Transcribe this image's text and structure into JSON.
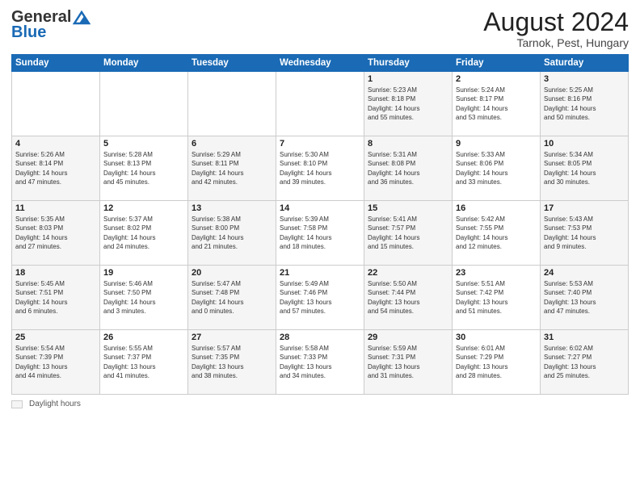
{
  "header": {
    "logo_general": "General",
    "logo_blue": "Blue",
    "month_year": "August 2024",
    "location": "Tarnok, Pest, Hungary"
  },
  "weekdays": [
    "Sunday",
    "Monday",
    "Tuesday",
    "Wednesday",
    "Thursday",
    "Friday",
    "Saturday"
  ],
  "legend": {
    "label": "Daylight hours",
    "box_color": "#f5f5f5"
  },
  "weeks": [
    [
      {
        "day": "",
        "info": ""
      },
      {
        "day": "",
        "info": ""
      },
      {
        "day": "",
        "info": ""
      },
      {
        "day": "",
        "info": ""
      },
      {
        "day": "1",
        "info": "Sunrise: 5:23 AM\nSunset: 8:18 PM\nDaylight: 14 hours\nand 55 minutes."
      },
      {
        "day": "2",
        "info": "Sunrise: 5:24 AM\nSunset: 8:17 PM\nDaylight: 14 hours\nand 53 minutes."
      },
      {
        "day": "3",
        "info": "Sunrise: 5:25 AM\nSunset: 8:16 PM\nDaylight: 14 hours\nand 50 minutes."
      }
    ],
    [
      {
        "day": "4",
        "info": "Sunrise: 5:26 AM\nSunset: 8:14 PM\nDaylight: 14 hours\nand 47 minutes."
      },
      {
        "day": "5",
        "info": "Sunrise: 5:28 AM\nSunset: 8:13 PM\nDaylight: 14 hours\nand 45 minutes."
      },
      {
        "day": "6",
        "info": "Sunrise: 5:29 AM\nSunset: 8:11 PM\nDaylight: 14 hours\nand 42 minutes."
      },
      {
        "day": "7",
        "info": "Sunrise: 5:30 AM\nSunset: 8:10 PM\nDaylight: 14 hours\nand 39 minutes."
      },
      {
        "day": "8",
        "info": "Sunrise: 5:31 AM\nSunset: 8:08 PM\nDaylight: 14 hours\nand 36 minutes."
      },
      {
        "day": "9",
        "info": "Sunrise: 5:33 AM\nSunset: 8:06 PM\nDaylight: 14 hours\nand 33 minutes."
      },
      {
        "day": "10",
        "info": "Sunrise: 5:34 AM\nSunset: 8:05 PM\nDaylight: 14 hours\nand 30 minutes."
      }
    ],
    [
      {
        "day": "11",
        "info": "Sunrise: 5:35 AM\nSunset: 8:03 PM\nDaylight: 14 hours\nand 27 minutes."
      },
      {
        "day": "12",
        "info": "Sunrise: 5:37 AM\nSunset: 8:02 PM\nDaylight: 14 hours\nand 24 minutes."
      },
      {
        "day": "13",
        "info": "Sunrise: 5:38 AM\nSunset: 8:00 PM\nDaylight: 14 hours\nand 21 minutes."
      },
      {
        "day": "14",
        "info": "Sunrise: 5:39 AM\nSunset: 7:58 PM\nDaylight: 14 hours\nand 18 minutes."
      },
      {
        "day": "15",
        "info": "Sunrise: 5:41 AM\nSunset: 7:57 PM\nDaylight: 14 hours\nand 15 minutes."
      },
      {
        "day": "16",
        "info": "Sunrise: 5:42 AM\nSunset: 7:55 PM\nDaylight: 14 hours\nand 12 minutes."
      },
      {
        "day": "17",
        "info": "Sunrise: 5:43 AM\nSunset: 7:53 PM\nDaylight: 14 hours\nand 9 minutes."
      }
    ],
    [
      {
        "day": "18",
        "info": "Sunrise: 5:45 AM\nSunset: 7:51 PM\nDaylight: 14 hours\nand 6 minutes."
      },
      {
        "day": "19",
        "info": "Sunrise: 5:46 AM\nSunset: 7:50 PM\nDaylight: 14 hours\nand 3 minutes."
      },
      {
        "day": "20",
        "info": "Sunrise: 5:47 AM\nSunset: 7:48 PM\nDaylight: 14 hours\nand 0 minutes."
      },
      {
        "day": "21",
        "info": "Sunrise: 5:49 AM\nSunset: 7:46 PM\nDaylight: 13 hours\nand 57 minutes."
      },
      {
        "day": "22",
        "info": "Sunrise: 5:50 AM\nSunset: 7:44 PM\nDaylight: 13 hours\nand 54 minutes."
      },
      {
        "day": "23",
        "info": "Sunrise: 5:51 AM\nSunset: 7:42 PM\nDaylight: 13 hours\nand 51 minutes."
      },
      {
        "day": "24",
        "info": "Sunrise: 5:53 AM\nSunset: 7:40 PM\nDaylight: 13 hours\nand 47 minutes."
      }
    ],
    [
      {
        "day": "25",
        "info": "Sunrise: 5:54 AM\nSunset: 7:39 PM\nDaylight: 13 hours\nand 44 minutes."
      },
      {
        "day": "26",
        "info": "Sunrise: 5:55 AM\nSunset: 7:37 PM\nDaylight: 13 hours\nand 41 minutes."
      },
      {
        "day": "27",
        "info": "Sunrise: 5:57 AM\nSunset: 7:35 PM\nDaylight: 13 hours\nand 38 minutes."
      },
      {
        "day": "28",
        "info": "Sunrise: 5:58 AM\nSunset: 7:33 PM\nDaylight: 13 hours\nand 34 minutes."
      },
      {
        "day": "29",
        "info": "Sunrise: 5:59 AM\nSunset: 7:31 PM\nDaylight: 13 hours\nand 31 minutes."
      },
      {
        "day": "30",
        "info": "Sunrise: 6:01 AM\nSunset: 7:29 PM\nDaylight: 13 hours\nand 28 minutes."
      },
      {
        "day": "31",
        "info": "Sunrise: 6:02 AM\nSunset: 7:27 PM\nDaylight: 13 hours\nand 25 minutes."
      }
    ]
  ]
}
